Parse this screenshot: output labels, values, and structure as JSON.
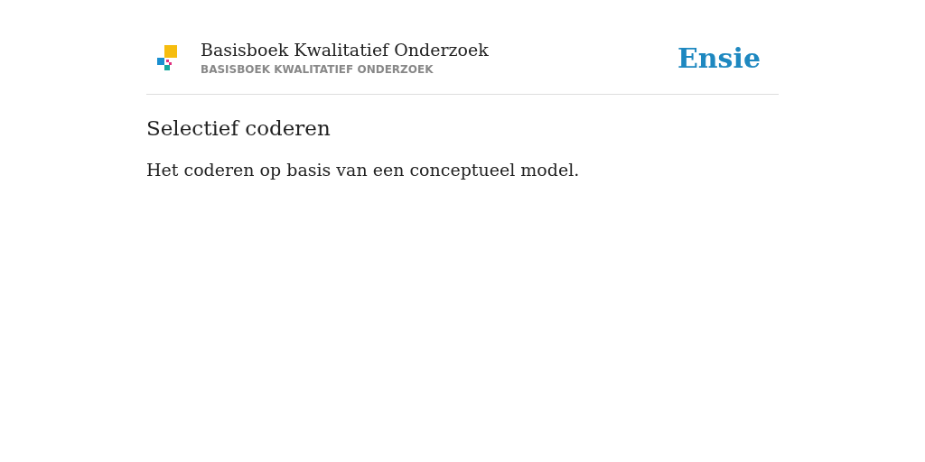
{
  "header": {
    "title": "Basisboek Kwalitatief Onderzoek",
    "subtitle": "BASISBOEK KWALITATIEF ONDERZOEK",
    "brand": "Ensie"
  },
  "entry": {
    "heading": "Selectief coderen",
    "definition": "Het coderen op basis van een conceptueel model."
  }
}
